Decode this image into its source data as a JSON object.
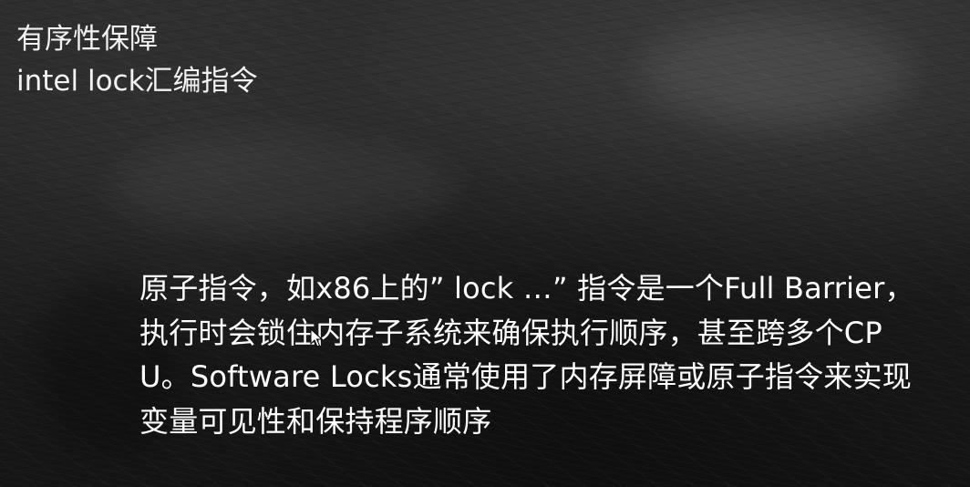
{
  "slide": {
    "title_line_1": "有序性保障",
    "title_line_2": "intel lock汇编指令",
    "body": "原子指令，如x86上的” lock …” 指令是一个Full Barrier，执行时会锁住内存子系统来确保执行顺序，甚至跨多个CPU。Software Locks通常使用了内存屏障或原子指令来实现变量可见性和保持程序顺序",
    "background_color": "#1e1e1e",
    "text_color": "#ffffff"
  },
  "pointer": {
    "icon": "mouse-cursor-icon"
  }
}
